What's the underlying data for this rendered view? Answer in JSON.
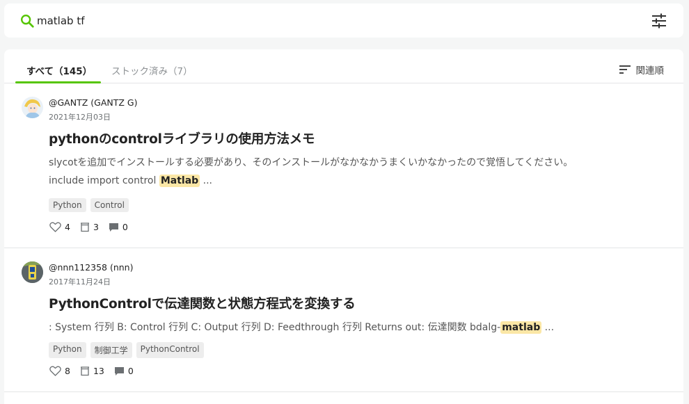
{
  "search": {
    "query": "matlab tf"
  },
  "tabs": [
    {
      "label": "すべて（145）"
    },
    {
      "label": "ストック済み（7）"
    }
  ],
  "sort": {
    "label": "関連順"
  },
  "articles": [
    {
      "author": "@GANTZ (GANTZ G)",
      "date": "2021年12月03日",
      "title": "pythonのcontrolライブラリの使用方法メモ",
      "snippet_line1": "slycotを追加でインストールする必要があり、そのインストールがなかなかうまくいかなかったので覚悟してください。",
      "snippet_line2_before": "include import control ",
      "snippet_line2_highlight": "Matlab",
      "snippet_line2_after": " ...",
      "tags": [
        "Python",
        "Control"
      ],
      "likes": "4",
      "stocks": "3",
      "comments": "0"
    },
    {
      "author": "@nnn112358 (nnn)",
      "date": "2017年11月24日",
      "title": "PythonControlで伝達関数と状態方程式を変換する",
      "snippet_line1_before": ": System 行列 B: Control 行列 C: Output 行列 D: Feedthrough 行列 Returns out: 伝達関数 bdalg-",
      "snippet_line1_highlight": "matlab",
      "snippet_line1_after": " ...",
      "tags": [
        "Python",
        "制御工学",
        "PythonControl"
      ],
      "likes": "8",
      "stocks": "13",
      "comments": "0"
    }
  ],
  "colors": {
    "accent": "#55c500",
    "highlight": "#fbe7a6",
    "background": "#f5f6f6"
  },
  "icons": {
    "search": "search-icon",
    "filter": "sliders-icon",
    "sort": "sort-lines-icon",
    "like": "heart-icon",
    "stock": "folder-icon",
    "comment": "comment-icon"
  }
}
